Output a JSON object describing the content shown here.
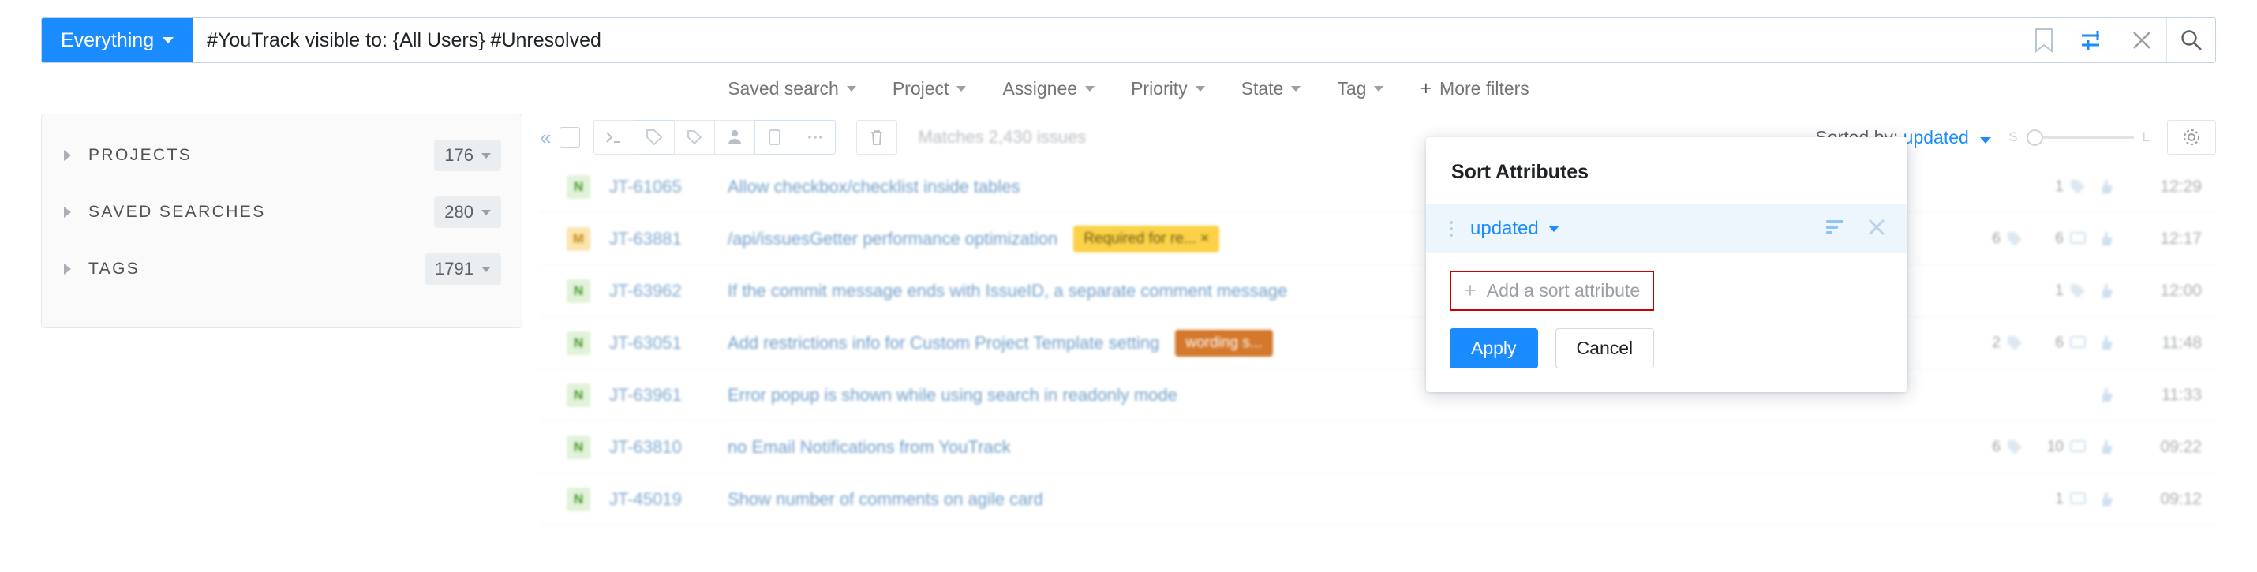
{
  "search": {
    "scope_label": "Everything",
    "query": "#YouTrack visible to: {All Users} #Unresolved",
    "icons": {
      "bookmark": "bookmark-icon",
      "filters": "filter-sliders-icon",
      "clear": "close-icon",
      "search": "search-icon"
    }
  },
  "filters": [
    {
      "label": "Saved search",
      "has_chevron": true
    },
    {
      "label": "Project",
      "has_chevron": true
    },
    {
      "label": "Assignee",
      "has_chevron": true
    },
    {
      "label": "Priority",
      "has_chevron": true
    },
    {
      "label": "State",
      "has_chevron": true
    },
    {
      "label": "Tag",
      "has_chevron": true
    },
    {
      "label": "More filters",
      "has_chevron": false
    }
  ],
  "more_filters_plus": "+",
  "sidebar": {
    "items": [
      {
        "label": "Projects",
        "count": "176"
      },
      {
        "label": "Saved searches",
        "count": "280"
      },
      {
        "label": "Tags",
        "count": "1791"
      }
    ]
  },
  "toolbar": {
    "collapse": "«",
    "matches_text": "Matches 2,430 issues",
    "sorted_by_prefix": "Sorted by:",
    "sorted_by_value": "updated",
    "slider_min": "S",
    "slider_max": "L",
    "buttons": [
      "run-command-icon",
      "tag-icon",
      "tag-outline-icon",
      "assignee-icon",
      "copy-icon",
      "more-icon"
    ],
    "delete_button": "trash-icon",
    "settings_button": "gear-icon"
  },
  "issues": [
    {
      "priority": "N",
      "priority_type": "normal",
      "id": "JT-61065",
      "title": "Allow checkbox/checklist inside tables",
      "badge": null,
      "badge_type": null,
      "left_count": "",
      "attach_count": "1",
      "attach_icon": "tag-icon",
      "comment_count": "",
      "vote_icon": "thumbs-up-icon",
      "time": "12:29"
    },
    {
      "priority": "M",
      "priority_type": "major",
      "id": "JT-63881",
      "title": "/api/issuesGetter performance optimization",
      "badge": "Required for re... ×",
      "badge_type": "gold",
      "left_count": "6",
      "attach_count": "6",
      "attach_icon": "comment-icon",
      "comment_count": "6",
      "vote_icon": "thumbs-up-icon",
      "time": "12:17"
    },
    {
      "priority": "N",
      "priority_type": "normal",
      "id": "JT-63962",
      "title": "If the commit message ends with IssueID, a separate comment message",
      "badge": null,
      "badge_type": null,
      "left_count": "",
      "attach_count": "1",
      "attach_icon": "tag-icon",
      "comment_count": "",
      "vote_icon": "thumbs-up-icon",
      "time": "12:00"
    },
    {
      "priority": "N",
      "priority_type": "normal",
      "id": "JT-63051",
      "title": "Add restrictions info for Custom Project Template setting",
      "badge": "wording s...",
      "badge_type": "orange",
      "left_count": "2",
      "attach_count": "6",
      "attach_icon": "comment-icon",
      "comment_count": "6",
      "vote_icon": "thumbs-up-icon",
      "time": "11:48"
    },
    {
      "priority": "N",
      "priority_type": "normal",
      "id": "JT-63961",
      "title": "Error popup is shown while using search in readonly mode",
      "badge": null,
      "badge_type": null,
      "left_count": "",
      "attach_count": "",
      "attach_icon": "",
      "comment_count": "",
      "vote_icon": "thumbs-up-icon",
      "time": "11:33"
    },
    {
      "priority": "N",
      "priority_type": "normal",
      "id": "JT-63810",
      "title": "no Email Notifications from YouTrack",
      "badge": null,
      "badge_type": null,
      "left_count": "6",
      "attach_count": "10",
      "attach_icon": "comment-icon",
      "comment_count": "10",
      "vote_icon": "thumbs-up-icon",
      "time": "09:22"
    },
    {
      "priority": "N",
      "priority_type": "normal",
      "id": "JT-45019",
      "title": "Show number of comments on agile card",
      "badge": null,
      "badge_type": null,
      "left_count": "",
      "attach_count": "1",
      "attach_icon": "comment-icon",
      "comment_count": "1",
      "vote_icon": "thumbs-up-icon",
      "time": "09:12"
    }
  ],
  "sort_popup": {
    "title": "Sort Attributes",
    "attribute": "updated",
    "sort_order_icon": "sort-descending-icon",
    "remove_icon": "close-icon",
    "add_label": "Add a sort attribute",
    "add_plus": "+",
    "apply_label": "Apply",
    "cancel_label": "Cancel",
    "highlight_color": "#cc0000"
  },
  "colors": {
    "accent": "#1a8cff",
    "highlight_row": "#eef6fd",
    "normal_priority": "#4a9c2d",
    "major_priority": "#c88a17"
  }
}
